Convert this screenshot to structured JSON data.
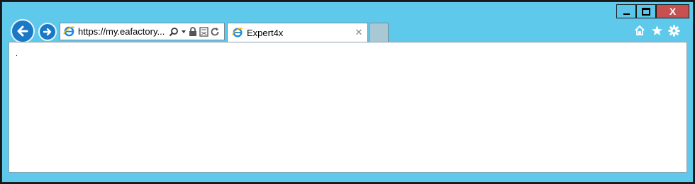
{
  "browser": {
    "address_bar": {
      "url": "https://my.eafactory...."
    },
    "tab": {
      "title": "Expert4x",
      "close_glyph": "✕"
    },
    "caption_buttons": {
      "close_label": "X"
    },
    "icons": {
      "back": "arrow-left-icon",
      "forward": "arrow-right-icon",
      "favicon": "ie-favicon-icon",
      "search": "search-icon",
      "dropdown": "chevron-down-icon",
      "lock": "lock-icon",
      "compat": "compatibility-view-icon",
      "refresh": "refresh-icon",
      "home": "home-icon",
      "favorites": "star-icon",
      "settings": "gear-icon"
    }
  },
  "content": {
    "text": "."
  },
  "colors": {
    "frame": "#5fc9ec",
    "close_button": "#c75050",
    "nav_button": "#1a78c6"
  }
}
